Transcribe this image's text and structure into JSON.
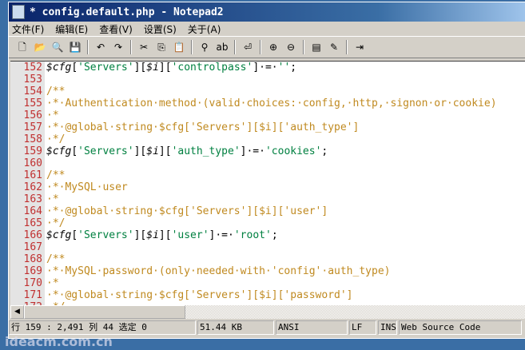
{
  "window": {
    "title": "* config.default.php - Notepad2"
  },
  "menu": [
    "文件(F)",
    "编辑(E)",
    "查看(V)",
    "设置(S)",
    "关于(A)"
  ],
  "toolbar": [
    "new-icon",
    "open-icon",
    "browse-icon",
    "save-icon",
    "|",
    "undo-icon",
    "redo-icon",
    "|",
    "cut-icon",
    "copy-icon",
    "paste-icon",
    "|",
    "find-icon",
    "replace-icon",
    "|",
    "word-wrap-icon",
    "|",
    "zoom-in-icon",
    "zoom-out-icon",
    "|",
    "scheme-icon",
    "customize-scheme-icon",
    "|",
    "exit-icon"
  ],
  "lines": [
    {
      "n": "152",
      "t": [
        [
          "k",
          "$cfg"
        ],
        [
          "p",
          "["
        ],
        [
          "s",
          "'Servers'"
        ],
        [
          "p",
          "]["
        ],
        [
          "k",
          "$i"
        ],
        [
          "p",
          "]["
        ],
        [
          "s",
          "'controlpass'"
        ],
        [
          "p",
          "]·=·"
        ],
        [
          "s",
          "''"
        ],
        [
          "p",
          ";"
        ]
      ]
    },
    {
      "n": "153",
      "t": []
    },
    {
      "n": "154",
      "t": [
        [
          "c",
          "/**"
        ]
      ]
    },
    {
      "n": "155",
      "t": [
        [
          "c",
          "·*·Authentication·method·(valid·choices:·config,·http,·signon·or·cookie)"
        ]
      ]
    },
    {
      "n": "156",
      "t": [
        [
          "c",
          "·*"
        ]
      ]
    },
    {
      "n": "157",
      "t": [
        [
          "c",
          "·*·@global·string·$cfg['Servers'][$i]['auth_type']"
        ]
      ]
    },
    {
      "n": "158",
      "t": [
        [
          "c",
          "·*/"
        ]
      ]
    },
    {
      "n": "159",
      "t": [
        [
          "k",
          "$cfg"
        ],
        [
          "p",
          "["
        ],
        [
          "s",
          "'Servers'"
        ],
        [
          "p",
          "]["
        ],
        [
          "k",
          "$i"
        ],
        [
          "p",
          "]["
        ],
        [
          "s",
          "'auth_type'"
        ],
        [
          "p",
          "]·=·"
        ],
        [
          "s",
          "'cookies'"
        ],
        [
          "p",
          ";"
        ]
      ]
    },
    {
      "n": "160",
      "t": []
    },
    {
      "n": "161",
      "t": [
        [
          "c",
          "/**"
        ]
      ]
    },
    {
      "n": "162",
      "t": [
        [
          "c",
          "·*·MySQL·user"
        ]
      ]
    },
    {
      "n": "163",
      "t": [
        [
          "c",
          "·*"
        ]
      ]
    },
    {
      "n": "164",
      "t": [
        [
          "c",
          "·*·@global·string·$cfg['Servers'][$i]['user']"
        ]
      ]
    },
    {
      "n": "165",
      "t": [
        [
          "c",
          "·*/"
        ]
      ]
    },
    {
      "n": "166",
      "t": [
        [
          "k",
          "$cfg"
        ],
        [
          "p",
          "["
        ],
        [
          "s",
          "'Servers'"
        ],
        [
          "p",
          "]["
        ],
        [
          "k",
          "$i"
        ],
        [
          "p",
          "]["
        ],
        [
          "s",
          "'user'"
        ],
        [
          "p",
          "]·=·"
        ],
        [
          "s",
          "'root'"
        ],
        [
          "p",
          ";"
        ]
      ]
    },
    {
      "n": "167",
      "t": []
    },
    {
      "n": "168",
      "t": [
        [
          "c",
          "/**"
        ]
      ]
    },
    {
      "n": "169",
      "t": [
        [
          "c",
          "·*·MySQL·password·(only·needed·with·'config'·auth_type)"
        ]
      ]
    },
    {
      "n": "170",
      "t": [
        [
          "c",
          "·*"
        ]
      ]
    },
    {
      "n": "171",
      "t": [
        [
          "c",
          "·*·@global·string·$cfg['Servers'][$i]['password']"
        ]
      ]
    },
    {
      "n": "172",
      "t": [
        [
          "c",
          "·*/"
        ]
      ]
    }
  ],
  "status": {
    "position": "行 159 : 2,491   列 44   选定 0",
    "size": "51.44 KB",
    "encoding": "ANSI",
    "eol": "LF",
    "mode": "INS",
    "scheme": "Web Source Code"
  },
  "watermark": "ideacm.com.cn"
}
